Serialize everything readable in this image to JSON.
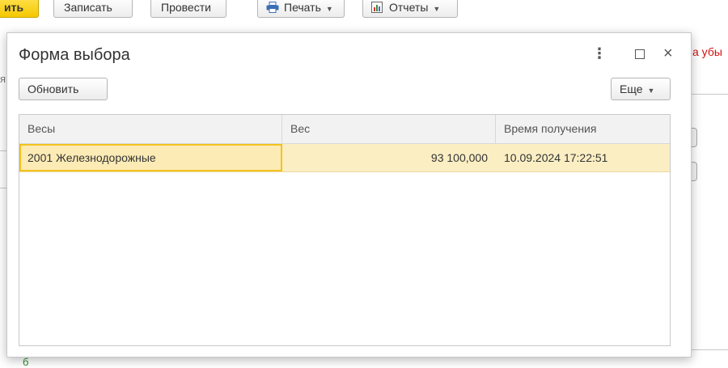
{
  "toolbar": {
    "primary_label": "ить",
    "save_label": "Записать",
    "post_label": "Провести",
    "print_label": "Печать",
    "reports_label": "Отчеты"
  },
  "background": {
    "red_text": "а убы",
    "left_char": "я",
    "bottom_text": "б"
  },
  "dialog": {
    "title": "Форма выбора",
    "refresh_label": "Обновить",
    "more_label": "Еще",
    "columns": [
      "Весы",
      "Вес",
      "Время получения"
    ],
    "rows": [
      {
        "scale": "2001 Железнодорожные",
        "weight": "93 100,000",
        "time": "10.09.2024 17:22:51"
      }
    ]
  }
}
